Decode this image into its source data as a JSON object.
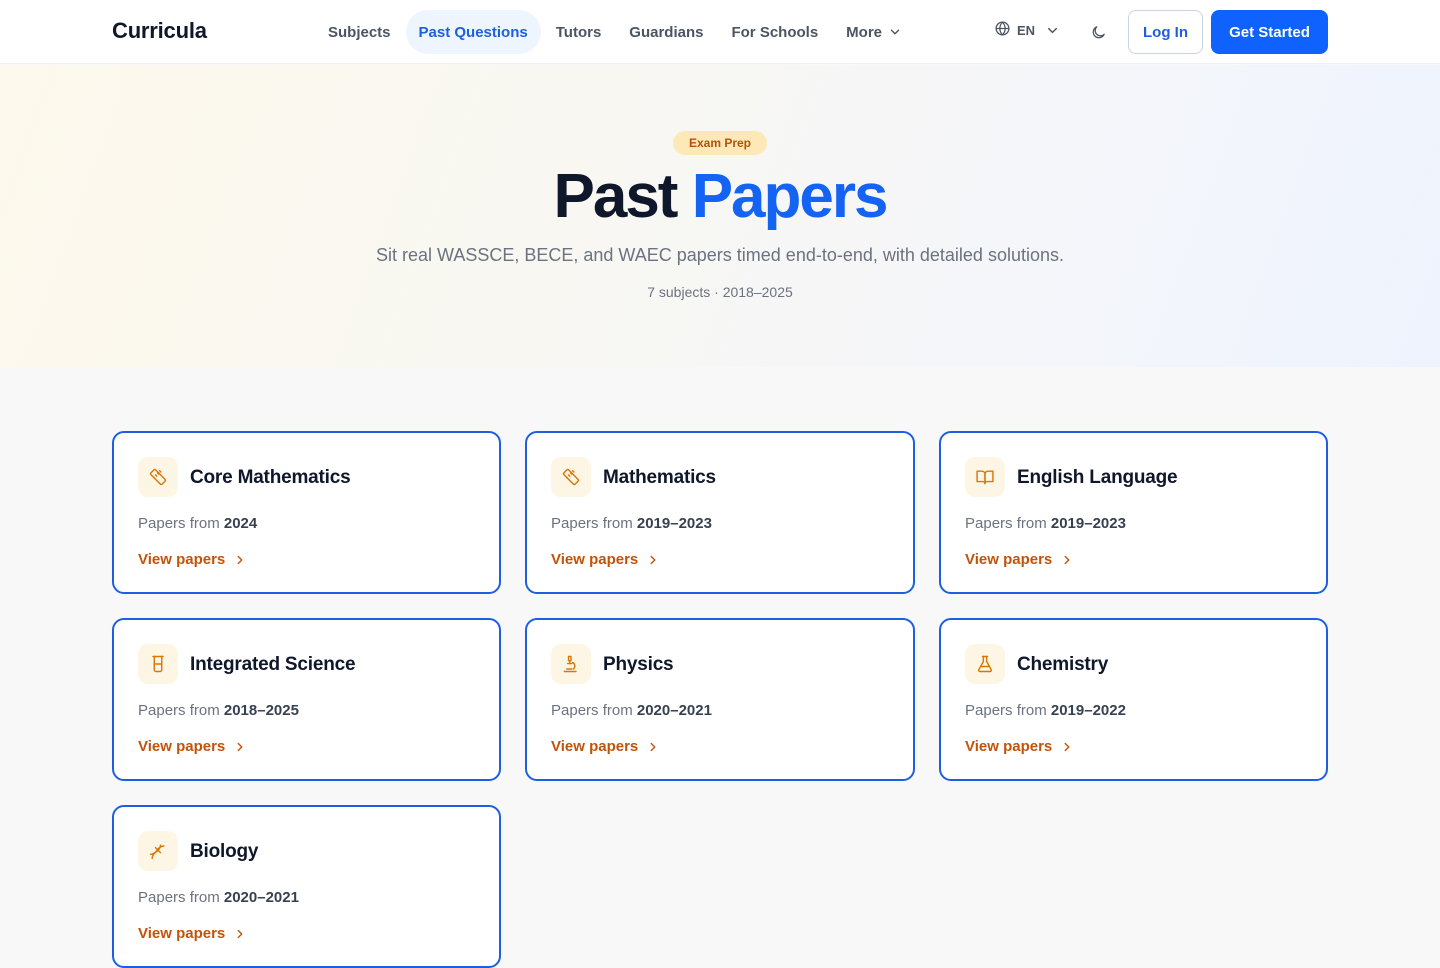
{
  "header": {
    "logo": "Curricula",
    "nav": [
      {
        "label": "Subjects",
        "active": false
      },
      {
        "label": "Past Questions",
        "active": true
      },
      {
        "label": "Tutors",
        "active": false
      },
      {
        "label": "Guardians",
        "active": false
      },
      {
        "label": "For Schools",
        "active": false
      },
      {
        "label": "More",
        "active": false
      }
    ],
    "language": "EN",
    "login_label": "Log In",
    "start_label": "Get Started"
  },
  "hero": {
    "badge": "Exam Prep",
    "title_main": "Past",
    "title_accent": "Papers",
    "subtitle": "Sit real WASSCE, BECE, and WAEC papers timed end-to-end, with detailed solutions.",
    "meta": "7 subjects · 2018–2025"
  },
  "cards": [
    {
      "title": "Core Mathematics",
      "papers_prefix": "Papers from",
      "years": "2024",
      "link": "View papers",
      "icon": "ruler-icon"
    },
    {
      "title": "Mathematics",
      "papers_prefix": "Papers from",
      "years": "2019–2023",
      "link": "View papers",
      "icon": "ruler-icon"
    },
    {
      "title": "English Language",
      "papers_prefix": "Papers from",
      "years": "2019–2023",
      "link": "View papers",
      "icon": "book-icon"
    },
    {
      "title": "Integrated Science",
      "papers_prefix": "Papers from",
      "years": "2018–2025",
      "link": "View papers",
      "icon": "beaker-icon"
    },
    {
      "title": "Physics",
      "papers_prefix": "Papers from",
      "years": "2020–2021",
      "link": "View papers",
      "icon": "microscope-icon"
    },
    {
      "title": "Chemistry",
      "papers_prefix": "Papers from",
      "years": "2019–2022",
      "link": "View papers",
      "icon": "flask-icon"
    },
    {
      "title": "Biology",
      "papers_prefix": "Papers from",
      "years": "2020–2021",
      "link": "View papers",
      "icon": "dna-icon"
    }
  ],
  "colors": {
    "primary": "#0f62fe",
    "accent_orange": "#c2540a",
    "card_border": "#1d5fe0",
    "badge_bg": "#fde9b8"
  }
}
